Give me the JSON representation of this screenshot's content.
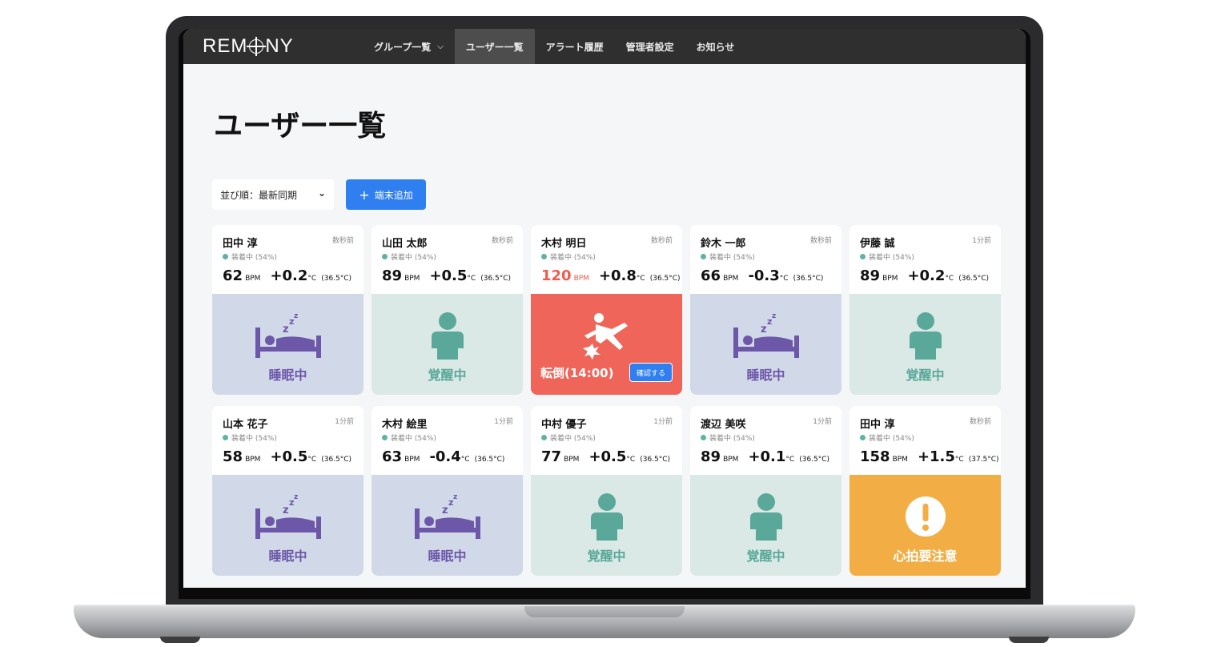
{
  "nav": {
    "logo": "REM",
    "logo_suffix": "NY",
    "items": [
      {
        "label": "グループ一覧"
      },
      {
        "label": "ユーザー一覧"
      },
      {
        "label": "アラート履歴"
      },
      {
        "label": "管理者設定"
      },
      {
        "label": "お知らせ"
      }
    ],
    "active_index": 1
  },
  "page": {
    "title": "ユーザー一覧",
    "sort_label": "並び順：最新同期",
    "add_button": "端末追加"
  },
  "colors": {
    "accent": "#2f7ff0",
    "sleep_bg": "#d1d9e9",
    "sleep_fg": "#6d57a8",
    "awake_bg": "#dae9e6",
    "awake_fg": "#5aa89a",
    "fall_bg": "#f0655a",
    "heart_bg": "#f2ae45"
  },
  "users": [
    {
      "name": "田中 淳",
      "time": "数秒前",
      "wear": "装着中 (54%)",
      "bpm": "62",
      "bpm_unit": "BPM",
      "temp": "+0.2",
      "temp_unit": "°C",
      "temp_base": "(36.5°C)",
      "status": "sleep",
      "status_label": "睡眠中"
    },
    {
      "name": "山田 太郎",
      "time": "数秒前",
      "wear": "装着中 (54%)",
      "bpm": "89",
      "bpm_unit": "BPM",
      "temp": "+0.5",
      "temp_unit": "°C",
      "temp_base": "(36.5°C)",
      "status": "awake",
      "status_label": "覚醒中"
    },
    {
      "name": "木村 明日",
      "time": "数秒前",
      "wear": "装着中 (54%)",
      "bpm": "120",
      "bpm_unit": "BPM",
      "temp": "+0.8",
      "temp_unit": "°C",
      "temp_base": "(36.5°C)",
      "status": "fall",
      "status_label": "転倒(14:00)",
      "action": "確認する",
      "alert_bpm": true
    },
    {
      "name": "鈴木 一郎",
      "time": "数秒前",
      "wear": "装着中 (54%)",
      "bpm": "66",
      "bpm_unit": "BPM",
      "temp": "-0.3",
      "temp_unit": "°C",
      "temp_base": "(36.5°C)",
      "status": "sleep",
      "status_label": "睡眠中"
    },
    {
      "name": "伊藤 誠",
      "time": "1分前",
      "wear": "装着中 (54%)",
      "bpm": "89",
      "bpm_unit": "BPM",
      "temp": "+0.2",
      "temp_unit": "°C",
      "temp_base": "(36.5°C)",
      "status": "awake",
      "status_label": "覚醒中"
    },
    {
      "name": "山本 花子",
      "time": "1分前",
      "wear": "装着中 (54%)",
      "bpm": "58",
      "bpm_unit": "BPM",
      "temp": "+0.5",
      "temp_unit": "°C",
      "temp_base": "(36.5°C)",
      "status": "sleep",
      "status_label": "睡眠中"
    },
    {
      "name": "木村 絵里",
      "time": "1分前",
      "wear": "装着中 (54%)",
      "bpm": "63",
      "bpm_unit": "BPM",
      "temp": "-0.4",
      "temp_unit": "°C",
      "temp_base": "(36.5°C)",
      "status": "sleep",
      "status_label": "睡眠中"
    },
    {
      "name": "中村 優子",
      "time": "1分前",
      "wear": "装着中 (54%)",
      "bpm": "77",
      "bpm_unit": "BPM",
      "temp": "+0.5",
      "temp_unit": "°C",
      "temp_base": "(36.5°C)",
      "status": "awake",
      "status_label": "覚醒中"
    },
    {
      "name": "渡辺 美咲",
      "time": "1分前",
      "wear": "装着中 (54%)",
      "bpm": "89",
      "bpm_unit": "BPM",
      "temp": "+0.1",
      "temp_unit": "°C",
      "temp_base": "(36.5°C)",
      "status": "awake",
      "status_label": "覚醒中"
    },
    {
      "name": "田中 淳",
      "time": "数秒前",
      "wear": "装着中 (54%)",
      "bpm": "158",
      "bpm_unit": "BPM",
      "temp": "+1.5",
      "temp_unit": "°C",
      "temp_base": "(37.5°C)",
      "status": "heart",
      "status_label": "心拍要注意"
    }
  ]
}
